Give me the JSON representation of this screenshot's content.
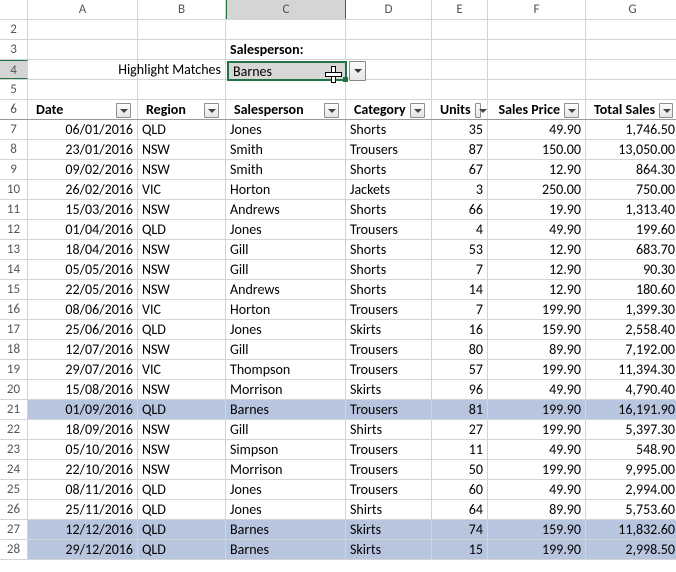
{
  "columns": [
    "A",
    "B",
    "C",
    "D",
    "E",
    "F",
    "G"
  ],
  "activeColumnIndex": 2,
  "activeRowIndex": 3,
  "rows_start": 2,
  "rows_end": 28,
  "labels": {
    "salesperson_label": "Salesperson:",
    "highlight_matches": "Highlight Matches",
    "dropdown_value": "Barnes"
  },
  "headers": {
    "A": "Date",
    "B": "Region",
    "C": "Salesperson",
    "D": "Category",
    "E": "Units",
    "F": "Sales Price",
    "G": "Total Sales"
  },
  "data_rows": [
    {
      "r": 7,
      "A": "06/01/2016",
      "B": "QLD",
      "C": "Jones",
      "D": "Shorts",
      "E": "35",
      "F": "49.90",
      "G": "1,746.50",
      "hl": false
    },
    {
      "r": 8,
      "A": "23/01/2016",
      "B": "NSW",
      "C": "Smith",
      "D": "Trousers",
      "E": "87",
      "F": "150.00",
      "G": "13,050.00",
      "hl": false
    },
    {
      "r": 9,
      "A": "09/02/2016",
      "B": "NSW",
      "C": "Smith",
      "D": "Shorts",
      "E": "67",
      "F": "12.90",
      "G": "864.30",
      "hl": false
    },
    {
      "r": 10,
      "A": "26/02/2016",
      "B": "VIC",
      "C": "Horton",
      "D": "Jackets",
      "E": "3",
      "F": "250.00",
      "G": "750.00",
      "hl": false
    },
    {
      "r": 11,
      "A": "15/03/2016",
      "B": "NSW",
      "C": "Andrews",
      "D": "Shorts",
      "E": "66",
      "F": "19.90",
      "G": "1,313.40",
      "hl": false
    },
    {
      "r": 12,
      "A": "01/04/2016",
      "B": "QLD",
      "C": "Jones",
      "D": "Trousers",
      "E": "4",
      "F": "49.90",
      "G": "199.60",
      "hl": false
    },
    {
      "r": 13,
      "A": "18/04/2016",
      "B": "NSW",
      "C": "Gill",
      "D": "Shorts",
      "E": "53",
      "F": "12.90",
      "G": "683.70",
      "hl": false
    },
    {
      "r": 14,
      "A": "05/05/2016",
      "B": "NSW",
      "C": "Gill",
      "D": "Shorts",
      "E": "7",
      "F": "12.90",
      "G": "90.30",
      "hl": false
    },
    {
      "r": 15,
      "A": "22/05/2016",
      "B": "NSW",
      "C": "Andrews",
      "D": "Shorts",
      "E": "14",
      "F": "12.90",
      "G": "180.60",
      "hl": false
    },
    {
      "r": 16,
      "A": "08/06/2016",
      "B": "VIC",
      "C": "Horton",
      "D": "Trousers",
      "E": "7",
      "F": "199.90",
      "G": "1,399.30",
      "hl": false
    },
    {
      "r": 17,
      "A": "25/06/2016",
      "B": "QLD",
      "C": "Jones",
      "D": "Skirts",
      "E": "16",
      "F": "159.90",
      "G": "2,558.40",
      "hl": false
    },
    {
      "r": 18,
      "A": "12/07/2016",
      "B": "NSW",
      "C": "Gill",
      "D": "Trousers",
      "E": "80",
      "F": "89.90",
      "G": "7,192.00",
      "hl": false
    },
    {
      "r": 19,
      "A": "29/07/2016",
      "B": "VIC",
      "C": "Thompson",
      "D": "Trousers",
      "E": "57",
      "F": "199.90",
      "G": "11,394.30",
      "hl": false
    },
    {
      "r": 20,
      "A": "15/08/2016",
      "B": "NSW",
      "C": "Morrison",
      "D": "Skirts",
      "E": "96",
      "F": "49.90",
      "G": "4,790.40",
      "hl": false
    },
    {
      "r": 21,
      "A": "01/09/2016",
      "B": "QLD",
      "C": "Barnes",
      "D": "Trousers",
      "E": "81",
      "F": "199.90",
      "G": "16,191.90",
      "hl": true
    },
    {
      "r": 22,
      "A": "18/09/2016",
      "B": "NSW",
      "C": "Gill",
      "D": "Shirts",
      "E": "27",
      "F": "199.90",
      "G": "5,397.30",
      "hl": false
    },
    {
      "r": 23,
      "A": "05/10/2016",
      "B": "NSW",
      "C": "Simpson",
      "D": "Trousers",
      "E": "11",
      "F": "49.90",
      "G": "548.90",
      "hl": false
    },
    {
      "r": 24,
      "A": "22/10/2016",
      "B": "NSW",
      "C": "Morrison",
      "D": "Trousers",
      "E": "50",
      "F": "199.90",
      "G": "9,995.00",
      "hl": false
    },
    {
      "r": 25,
      "A": "08/11/2016",
      "B": "QLD",
      "C": "Jones",
      "D": "Trousers",
      "E": "60",
      "F": "49.90",
      "G": "2,994.00",
      "hl": false
    },
    {
      "r": 26,
      "A": "25/11/2016",
      "B": "QLD",
      "C": "Jones",
      "D": "Shirts",
      "E": "64",
      "F": "89.90",
      "G": "5,753.60",
      "hl": false
    },
    {
      "r": 27,
      "A": "12/12/2016",
      "B": "QLD",
      "C": "Barnes",
      "D": "Skirts",
      "E": "74",
      "F": "159.90",
      "G": "11,832.60",
      "hl": true
    },
    {
      "r": 28,
      "A": "29/12/2016",
      "B": "QLD",
      "C": "Barnes",
      "D": "Skirts",
      "E": "15",
      "F": "199.90",
      "G": "2,998.50",
      "hl": true
    }
  ]
}
